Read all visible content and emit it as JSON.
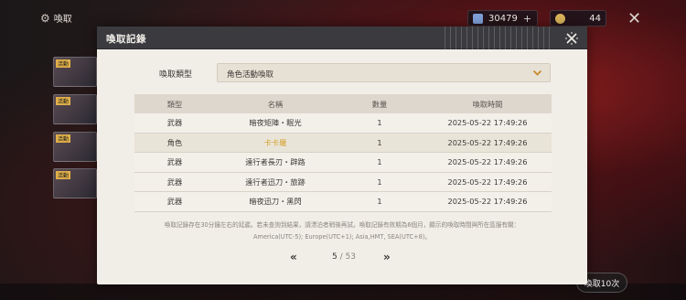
{
  "topbar": {
    "title": "喚取",
    "currency1": "30479",
    "currency2": "44"
  },
  "side_tabs": [
    "活動",
    "活動",
    "活動",
    "活動"
  ],
  "bottom": {
    "button_label": "喚取10次"
  },
  "modal": {
    "title": "喚取記錄",
    "filter_label": "喚取類型",
    "filter_value": "角色活動喚取",
    "table": {
      "headers": [
        "類型",
        "名稱",
        "數量",
        "喚取時間"
      ],
      "rows": [
        {
          "type": "武器",
          "name": "暗夜矩陣・眠光",
          "qty": "1",
          "time": "2025-05-22 17:49:26"
        },
        {
          "type": "角色",
          "name": "卡卡羅",
          "qty": "1",
          "time": "2025-05-22 17:49:26"
        },
        {
          "type": "武器",
          "name": "遠行者長刃・辟路",
          "qty": "1",
          "time": "2025-05-22 17:49:26"
        },
        {
          "type": "武器",
          "name": "遠行者迅刀・旅跡",
          "qty": "1",
          "time": "2025-05-22 17:49:26"
        },
        {
          "type": "武器",
          "name": "暗夜迅刀・黑閃",
          "qty": "1",
          "time": "2025-05-22 17:49:26"
        }
      ]
    },
    "note_line1": "喚取記錄存在30分鐘左右的延遲。若未查詢到結果，請漂泊者稍後再試。喚取記錄有效期為6個月，顯示的喚取時間與所在區服有關：",
    "note_line2": "America(UTC-5); Europe(UTC+1); Asia,HMT, SEA(UTC+8)。",
    "pager": {
      "current": "5",
      "separator": " / ",
      "total": "53"
    }
  },
  "colors": {
    "header_bg": "#3b3b3f",
    "panel_bg": "#f1eee8",
    "highlight_name": "#d4a12a"
  }
}
